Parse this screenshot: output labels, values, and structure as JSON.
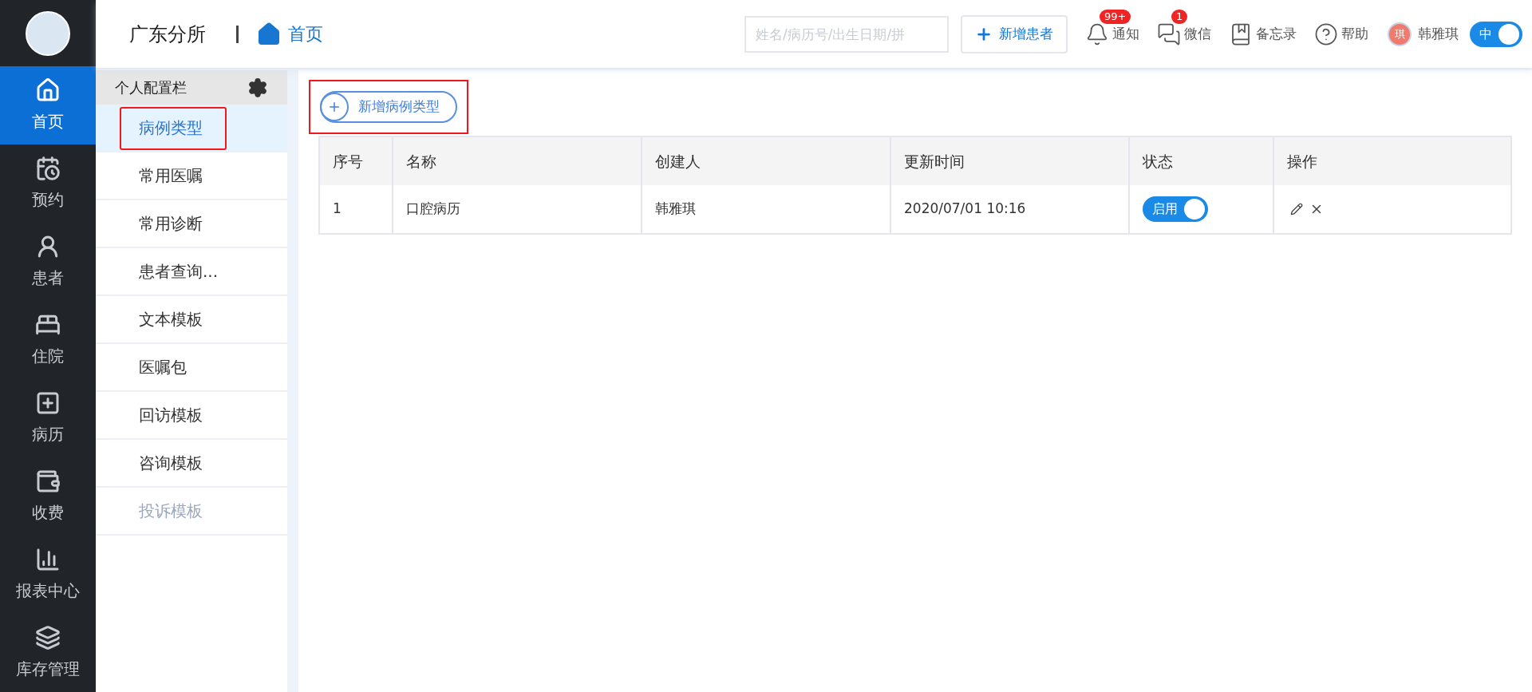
{
  "nav": {
    "items": [
      {
        "label": "首页",
        "selected": true
      },
      {
        "label": "预约",
        "selected": false
      },
      {
        "label": "患者",
        "selected": false
      },
      {
        "label": "住院",
        "selected": false
      },
      {
        "label": "病历",
        "selected": false
      },
      {
        "label": "收费",
        "selected": false
      },
      {
        "label": "报表中心",
        "selected": false
      },
      {
        "label": "库存管理",
        "selected": false
      }
    ]
  },
  "header": {
    "clinic": "广东分所",
    "breadcrumb": "首页",
    "search": {
      "placeholder": "姓名/病历号/出生日期/拼"
    },
    "add_patient": "新增患者",
    "tools": [
      {
        "kind": "bell",
        "label": "通知",
        "badge": "99+"
      },
      {
        "kind": "wechat",
        "label": "微信",
        "badge": "1"
      },
      {
        "kind": "book",
        "label": "备忘录"
      },
      {
        "kind": "help",
        "label": "帮助"
      }
    ],
    "user": {
      "avatar": "琪",
      "name": "韩雅琪"
    },
    "language_toggle": {
      "label": "中",
      "on": true
    }
  },
  "sidebar": {
    "title": "个人配置栏",
    "items": [
      {
        "label": "病例类型",
        "selected": true,
        "disabled": false
      },
      {
        "label": "常用医嘱",
        "selected": false,
        "disabled": false
      },
      {
        "label": "常用诊断",
        "selected": false,
        "disabled": false
      },
      {
        "label": "患者查询...",
        "selected": false,
        "disabled": false
      },
      {
        "label": "文本模板",
        "selected": false,
        "disabled": false
      },
      {
        "label": "医嘱包",
        "selected": false,
        "disabled": false
      },
      {
        "label": "回访模板",
        "selected": false,
        "disabled": false
      },
      {
        "label": "咨询模板",
        "selected": false,
        "disabled": false
      },
      {
        "label": "投诉模板",
        "selected": false,
        "disabled": true
      }
    ]
  },
  "main": {
    "add_button": "新增病例类型",
    "table": {
      "columns": [
        "序号",
        "名称",
        "创建人",
        "更新时间",
        "状态",
        "操作"
      ],
      "rows": [
        {
          "index": "1",
          "name": "口腔病历",
          "creator": "韩雅琪",
          "updated": "2020/07/01 10:16",
          "status": {
            "label": "启用",
            "on": true
          }
        }
      ]
    }
  }
}
